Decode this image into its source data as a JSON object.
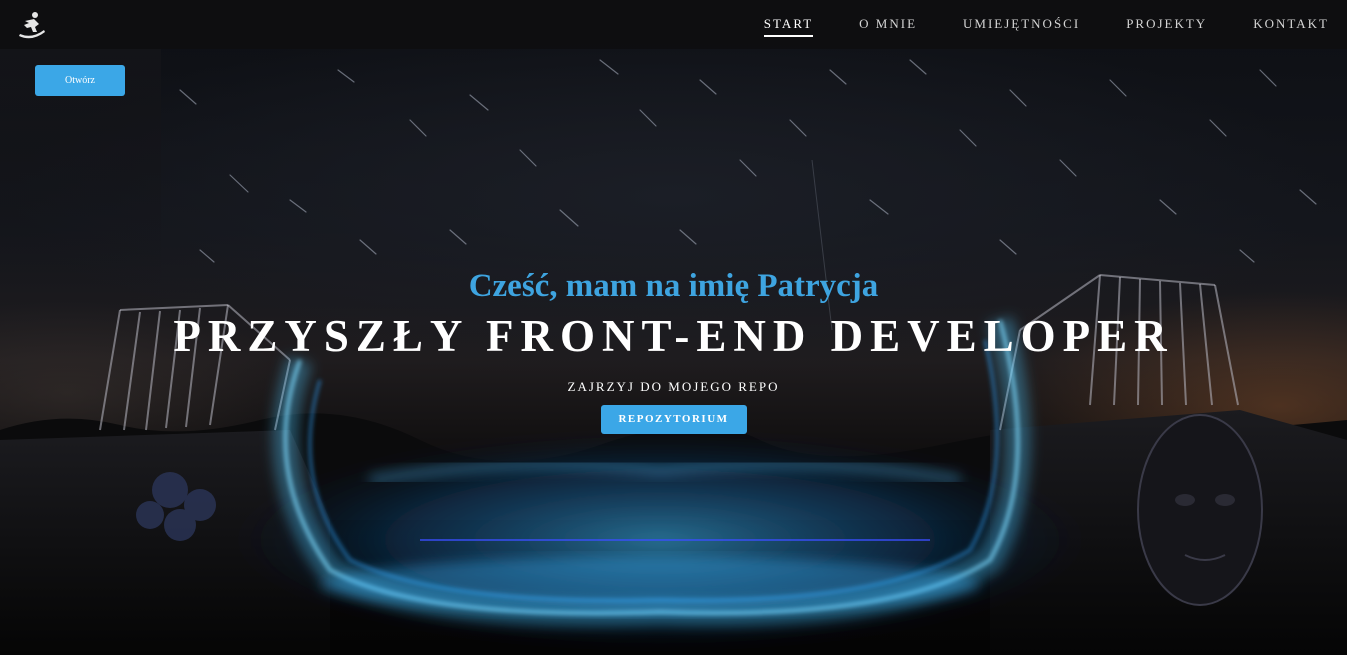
{
  "nav": {
    "logo_icon": "snowboarder-icon",
    "items": [
      {
        "label": "START",
        "active": true
      },
      {
        "label": "O MNIE",
        "active": false
      },
      {
        "label": "UMIEJĘTNOŚCI",
        "active": false
      },
      {
        "label": "PROJEKTY",
        "active": false
      },
      {
        "label": "KONTAKT",
        "active": false
      }
    ]
  },
  "side_panel": {
    "open_label": "Otwórz"
  },
  "hero": {
    "greeting": "Cześć, mam na imię Patrycja",
    "headline": "PRZYSZŁY FRONT-END DEVELOPER",
    "subline": "ZAJRZYJ DO MOJEGO REPO",
    "button_label": "REPOZYTORIUM"
  },
  "colors": {
    "accent": "#3ba7e7",
    "navbar": "#0e0e10",
    "headline": "#ffffff",
    "greeting": "#3ea4e0"
  }
}
